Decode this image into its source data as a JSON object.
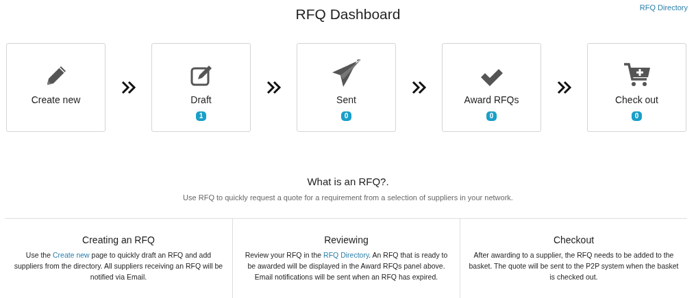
{
  "header": {
    "title": "RFQ Dashboard",
    "directory_link": "RFQ Directory"
  },
  "steps": [
    {
      "label": "Create new"
    },
    {
      "label": "Draft",
      "count": "1"
    },
    {
      "label": "Sent",
      "count": "0"
    },
    {
      "label": "Award RFQs",
      "count": "0"
    },
    {
      "label": "Check out",
      "count": "0"
    }
  ],
  "intro": {
    "heading": "What is an RFQ?.",
    "text": "Use RFQ to quickly request a quote for a requirement from a selection of suppliers in your network."
  },
  "info_columns": [
    {
      "heading": "Creating an RFQ",
      "text_before": "Use the ",
      "link": "Create new",
      "text_after": " page to quickly draft an RFQ and add suppliers from the directory. All suppliers receiving an RFQ will be notified via Email."
    },
    {
      "heading": "Reviewing",
      "text_before": "Review your RFQ in the ",
      "link": "RFQ Directory",
      "text_after": ". An RFQ that is ready to be awarded will be displayed in the Award RFQs panel above. Email notifications will be sent when an RFQ has expired."
    },
    {
      "heading": "Checkout",
      "text_before": "After awarding to a supplier, the RFQ needs to be added to the basket. The quote will be sent to the P2P system when the basket is checked out."
    }
  ]
}
